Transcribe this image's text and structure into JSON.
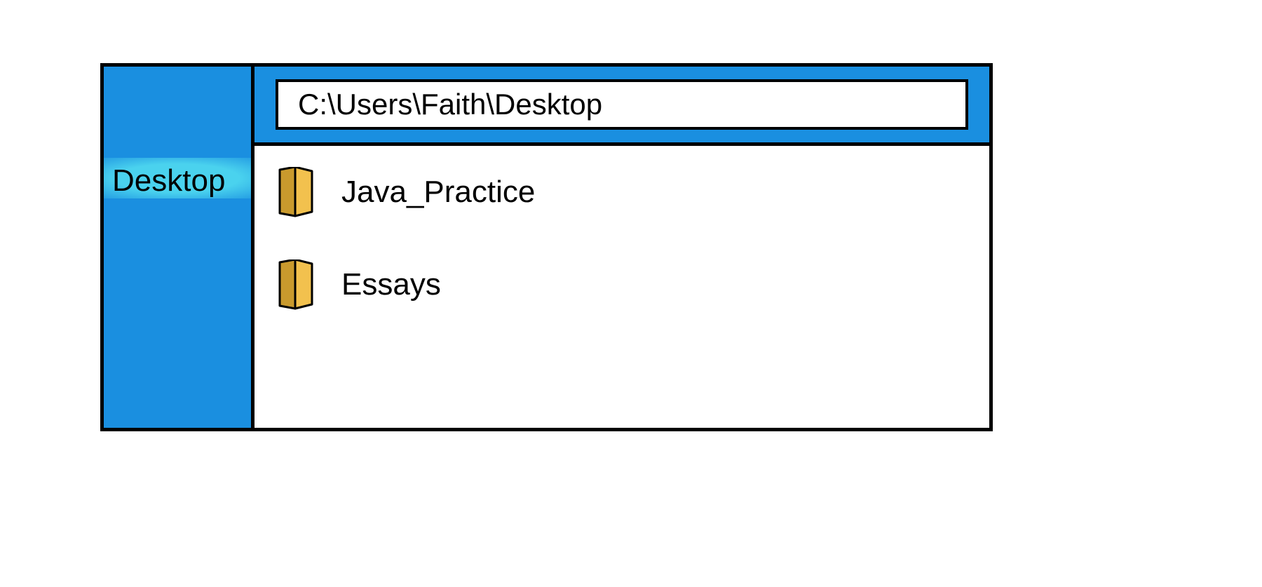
{
  "sidebar": {
    "items": [
      {
        "label": "Desktop",
        "selected": true
      }
    ]
  },
  "address_bar": {
    "value": "C:\\Users\\Faith\\Desktop"
  },
  "content": {
    "folders": [
      {
        "name": "Java_Practice"
      },
      {
        "name": "Essays"
      }
    ]
  },
  "colors": {
    "accent": "#1a8fe0",
    "highlight": "#4ad2ee",
    "folder": "#f2c14e",
    "folder_shadow": "#c99a2d"
  }
}
